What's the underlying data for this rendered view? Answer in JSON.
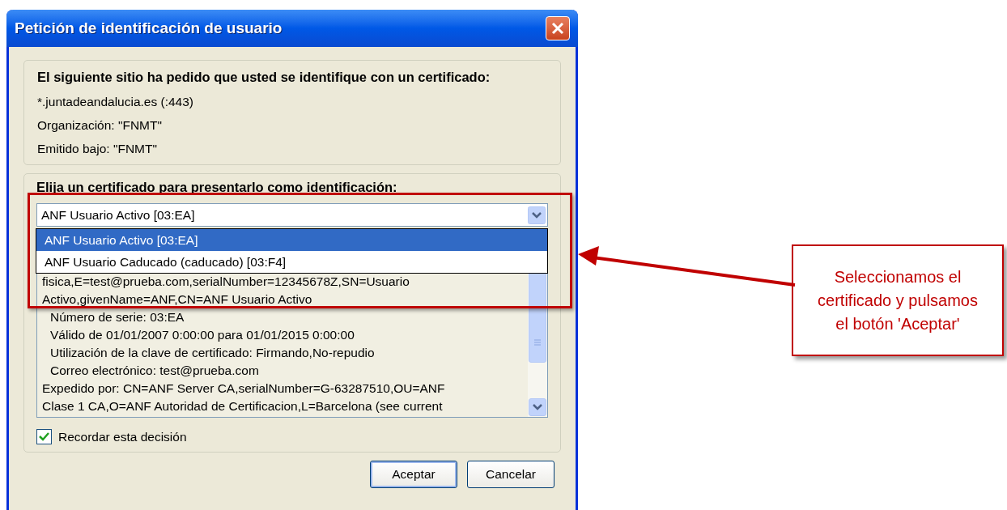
{
  "window": {
    "title": "Petición de identificación de usuario"
  },
  "site_group": {
    "heading": "El siguiente sitio ha pedido que usted se identifique con un certificado:",
    "lines": [
      "*.juntadeandalucia.es (:443)",
      "Organización: \"FNMT\"",
      "Emitido bajo: \"FNMT\""
    ]
  },
  "certificate_group": {
    "heading": "Elija un certificado para presentarlo como identificación:",
    "combo_value": "ANF Usuario Activo [03:EA]",
    "options": [
      {
        "label": "ANF Usuario Activo [03:EA]",
        "selected": true
      },
      {
        "label": "ANF Usuario Caducado (caducado) [03:F4]",
        "selected": false
      }
    ],
    "details": [
      {
        "text": "fisica,E=test@prueba.com,serialNumber=12345678Z,SN=Usuario",
        "indented": false
      },
      {
        "text": "Activo,givenName=ANF,CN=ANF Usuario Activo",
        "indented": false
      },
      {
        "text": "Número de serie: 03:EA",
        "indented": true
      },
      {
        "text": "Válido de 01/01/2007 0:00:00 para 01/01/2015 0:00:00",
        "indented": true
      },
      {
        "text": "Utilización de la clave de certificado: Firmando,No-repudio",
        "indented": true
      },
      {
        "text": "Correo electrónico: test@prueba.com",
        "indented": true
      },
      {
        "text": "Expedido por: CN=ANF Server CA,serialNumber=G-63287510,OU=ANF",
        "indented": false
      },
      {
        "text": "Clase 1 CA,O=ANF Autoridad de Certificacion,L=Barcelona (see current",
        "indented": false
      }
    ],
    "remember": {
      "label": "Recordar esta decisión",
      "checked": true
    }
  },
  "buttons": [
    {
      "label": "Aceptar",
      "default": true
    },
    {
      "label": "Cancelar",
      "default": false
    }
  ],
  "callout": {
    "text": "Seleccionamos el certificado y pulsamos el botón 'Aceptar'"
  }
}
